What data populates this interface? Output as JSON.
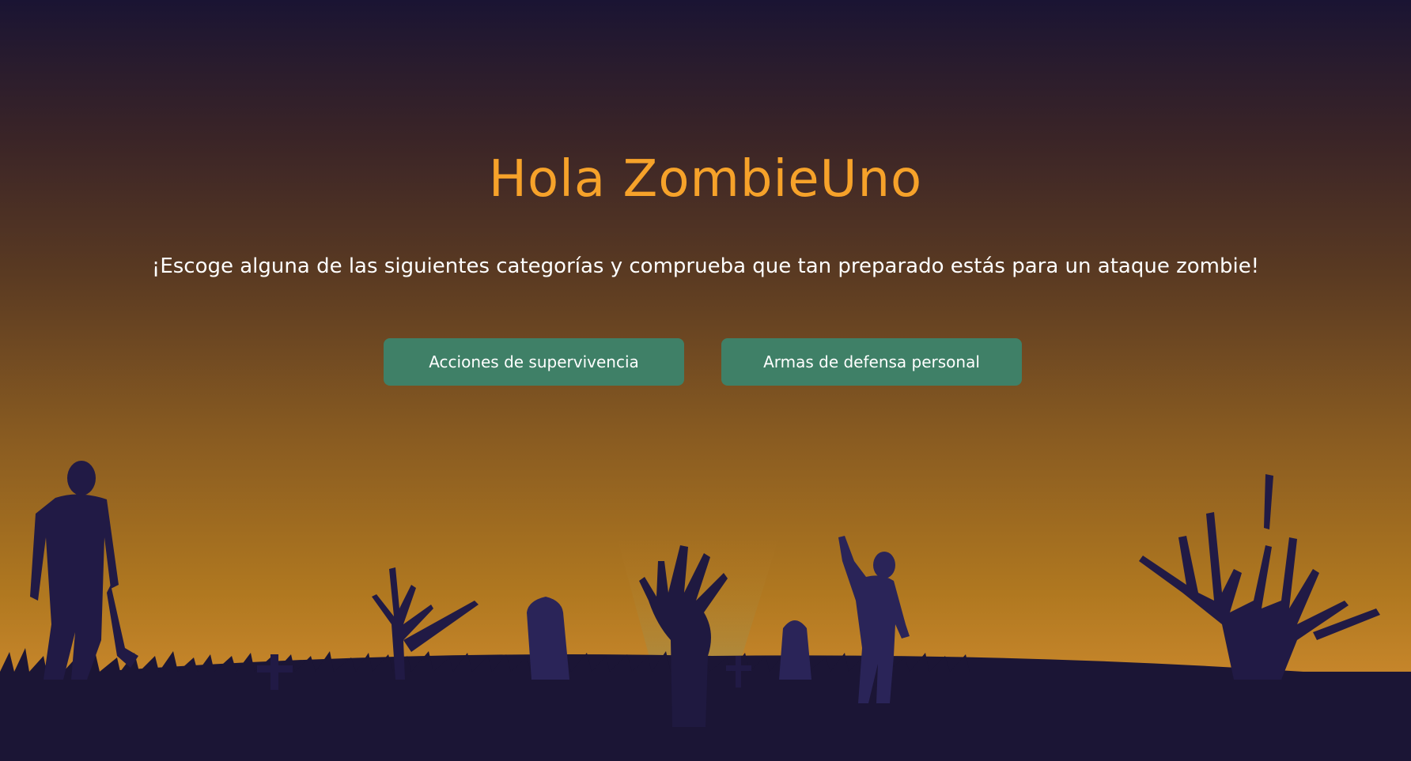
{
  "header": {
    "title": "Hola ZombieUno",
    "subtitle": "¡Escoge alguna de las siguientes categorías y comprueba que tan preparado estás para un ataque zombie!"
  },
  "categories": [
    {
      "label": "Acciones de supervivencia"
    },
    {
      "label": "Armas de defensa personal"
    }
  ],
  "colors": {
    "title": "#f6a22a",
    "button": "#3f8067",
    "silhouette": "#1b1535"
  },
  "scene": {
    "icons": [
      "zombie-left-icon",
      "dead-tree-icon",
      "cross-icon",
      "tombstone-icon",
      "zombie-hand-icon",
      "zombie-walking-icon",
      "dead-tree-right-icon"
    ]
  }
}
